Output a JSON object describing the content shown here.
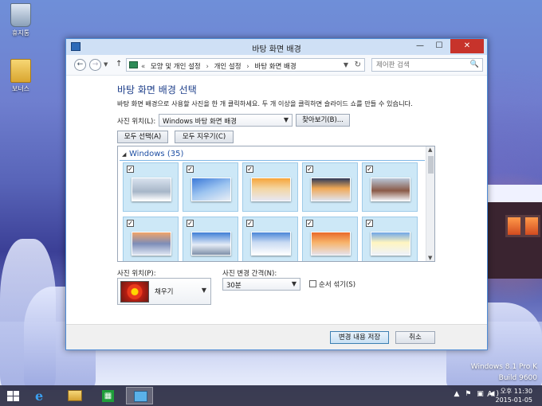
{
  "desktop": {
    "icons": [
      {
        "label": "휴지통",
        "icon": "recycle-bin-icon"
      },
      {
        "label": "보너스",
        "icon": "folder-icon"
      }
    ],
    "watermark": {
      "line1": "Windows 8.1 Pro K",
      "line2": "Build 9600"
    }
  },
  "window": {
    "title": "바탕 화면 배경",
    "controls": {
      "minimize": "—",
      "maximize": "☐",
      "close": "✕"
    },
    "nav": {
      "back": "←",
      "forward": "→",
      "history": "▼",
      "up": "↑",
      "breadcrumbs": [
        "«",
        "모양 및 개인 설정",
        "›",
        "개인 설정",
        "›",
        "바탕 화면 배경"
      ],
      "address_dropdown": "▼",
      "refresh": "↻",
      "search_placeholder": "제어판 검색",
      "search_icon": "🔍"
    },
    "heading": "바탕 화면 배경 선택",
    "description": "바탕 화면 배경으로 사용할 사진을 한 개 클릭하세요. 두 개 이상을 클릭하면 슬라이드 쇼를 만들 수 있습니다.",
    "picture_location_label": "사진 위치(L):",
    "picture_location_value": "Windows 바탕 화면 배경",
    "browse_button": "찾아보기(B)...",
    "select_all_button": "모두 선택(A)",
    "clear_all_button": "모두 지우기(C)",
    "gallery": {
      "group_title": "Windows (35)",
      "tiles_row1": [
        {
          "checked": "✓",
          "theme": "snowy-winter-cabin"
        },
        {
          "checked": "✓",
          "theme": "snowy-trees-blue-sky"
        },
        {
          "checked": "✓",
          "theme": "winter-sunset"
        },
        {
          "checked": "✓",
          "theme": "snow-field-sunrise"
        },
        {
          "checked": "✓",
          "theme": "winter-house"
        }
      ],
      "tiles_row2": [
        {
          "checked": "✓",
          "theme": "winter-lake-sunset"
        },
        {
          "checked": "✓",
          "theme": "snowy-mountains"
        },
        {
          "checked": "✓",
          "theme": "snow-hills"
        },
        {
          "checked": "✓",
          "theme": "orange-snowy-forest"
        },
        {
          "checked": "✓",
          "theme": "ski-slope-sun"
        }
      ]
    },
    "picture_position_label": "사진 위치(P):",
    "picture_position_value": "채우기",
    "interval_label": "사진 변경 간격(N):",
    "interval_value": "30분",
    "shuffle_label": "순서 섞기(S)",
    "save_button": "변경 내용 저장",
    "cancel_button": "취소"
  },
  "taskbar": {
    "tray_icons": "▲ ⚑ ▣ ◀)",
    "ime": "A",
    "time": "오후 11:30",
    "date": "2015-01-05"
  },
  "colors": {
    "accent": "#1e3f8a",
    "close_red": "#c7332b",
    "tile_bg": "#cde8f7"
  }
}
